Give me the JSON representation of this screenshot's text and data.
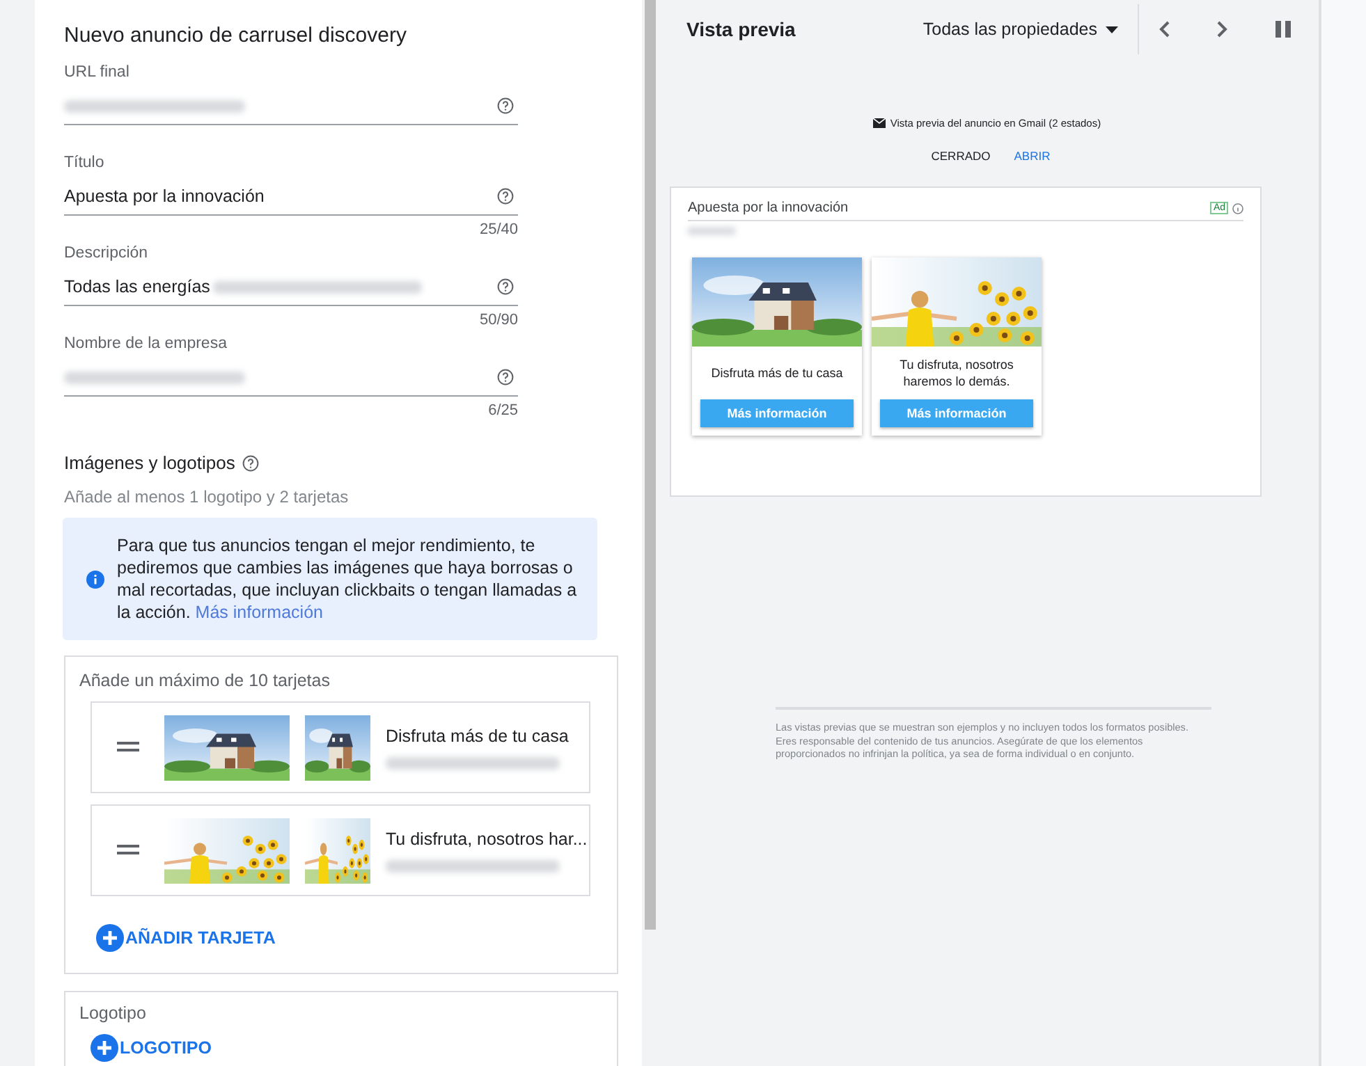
{
  "editor": {
    "title": "Nuevo anuncio de carrusel discovery",
    "fields": [
      {
        "label": "URL final",
        "blurred": true
      },
      {
        "label": "Título",
        "value": "Apuesta por la innovación",
        "counter": "25/40"
      },
      {
        "label": "Descripción",
        "value": "Todas las energías",
        "blurred": true,
        "counter": "50/90"
      },
      {
        "label": "Nombre de la empresa",
        "blurred": true,
        "counter": "6/25"
      }
    ],
    "images_section": {
      "title": "Imágenes y logotipos",
      "hint": "Añade al menos 1 logotipo y 2 tarjetas",
      "notice": {
        "text": "Para que tus anuncios tengan el mejor rendimiento, te pediremos que cambies las imágenes que haya borrosas o mal recortadas, que incluyan clickbaits o tengan llamadas a la acción.",
        "link": "Más información"
      }
    },
    "cards_section": {
      "title": "Añade un máximo de 10 tarjetas",
      "cards": [
        {
          "headline": "Disfruta más de tu casa",
          "kind": "house"
        },
        {
          "headline": "Tu disfruta, nosotros har...",
          "kind": "sunflowers"
        }
      ],
      "add_button": "AÑADIR TARJETA"
    },
    "logo_section": {
      "title": "Logotipo",
      "add_button": "LOGOTIPO"
    }
  },
  "preview": {
    "title": "Vista previa",
    "property_filter": "Todas las propiedades",
    "gmail_caption": "Vista previa del anuncio en Gmail (2 estados)",
    "states": [
      {
        "label": "CERRADO",
        "selected": true
      },
      {
        "label": "ABRIR",
        "selected": false
      }
    ],
    "ad": {
      "headline": "Apuesta por la innovación",
      "badge": "Ad",
      "cards": [
        {
          "kind": "house",
          "text": "Disfruta más de tu casa",
          "button": "Más información"
        },
        {
          "kind": "sunflowers",
          "text": "Tu disfruta, nosotros haremos lo demás.",
          "button": "Más información"
        }
      ]
    },
    "disclaimer": "Las vistas previas que se muestran son ejemplos y no incluyen todos los formatos posibles. Eres responsable del contenido de tus anuncios. Asegúrate de que los elementos proporcionados no infrinjan la política, ya sea de forma individual o en conjunto."
  }
}
